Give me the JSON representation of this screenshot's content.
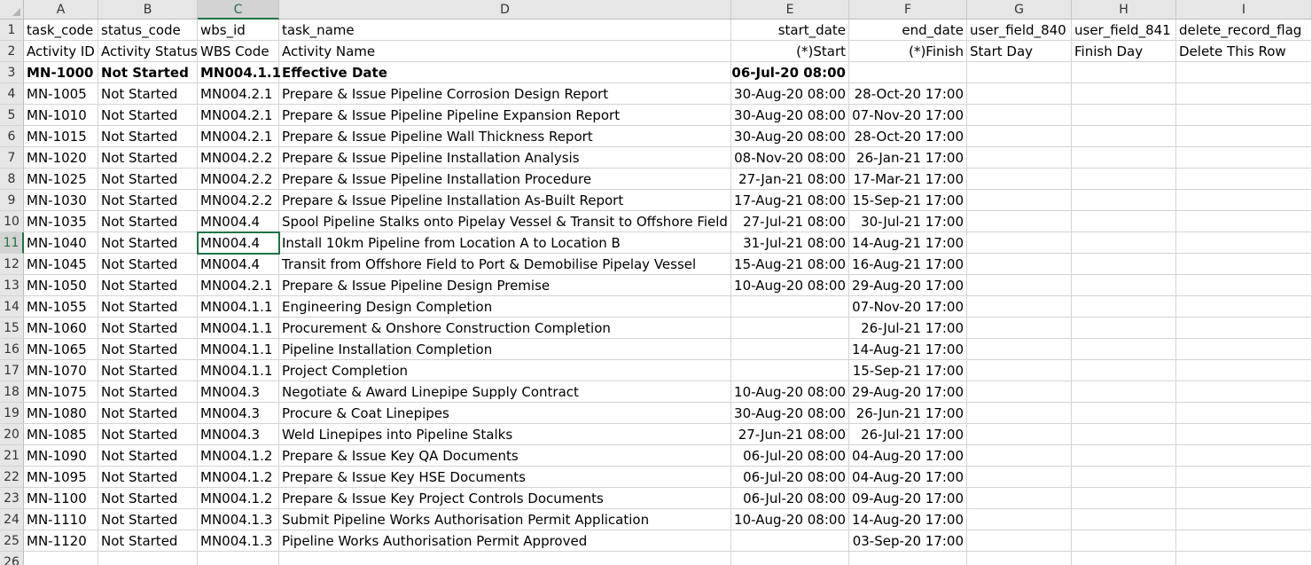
{
  "columns": [
    "A",
    "B",
    "C",
    "D",
    "E",
    "F",
    "G",
    "H",
    "I"
  ],
  "selected_column": "C",
  "selected_row": "11",
  "rows": [
    {
      "num": "1",
      "cells": [
        "task_code",
        "status_code",
        "wbs_id",
        "task_name",
        "start_date",
        "end_date",
        "user_field_840",
        "user_field_841",
        "delete_record_flag"
      ]
    },
    {
      "num": "2",
      "cells": [
        "Activity ID",
        "Activity Status",
        "WBS Code",
        "Activity Name",
        "(*)Start",
        "(*)Finish",
        "Start Day",
        "Finish Day",
        "Delete This Row"
      ]
    },
    {
      "num": "3",
      "bold": true,
      "cells": [
        "MN-1000",
        "Not Started",
        "MN004.1.1",
        "Effective Date",
        "06-Jul-20 08:00",
        "",
        "",
        "",
        ""
      ]
    },
    {
      "num": "4",
      "cells": [
        "MN-1005",
        "Not Started",
        "MN004.2.1",
        "Prepare & Issue Pipeline Corrosion Design Report",
        "30-Aug-20 08:00",
        "28-Oct-20 17:00",
        "",
        "",
        ""
      ]
    },
    {
      "num": "5",
      "cells": [
        "MN-1010",
        "Not Started",
        "MN004.2.1",
        "Prepare & Issue Pipeline Pipeline Expansion Report",
        "30-Aug-20 08:00",
        "07-Nov-20 17:00",
        "",
        "",
        ""
      ]
    },
    {
      "num": "6",
      "cells": [
        "MN-1015",
        "Not Started",
        "MN004.2.1",
        "Prepare & Issue Pipeline Wall Thickness Report",
        "30-Aug-20 08:00",
        "28-Oct-20 17:00",
        "",
        "",
        ""
      ]
    },
    {
      "num": "7",
      "cells": [
        "MN-1020",
        "Not Started",
        "MN004.2.2",
        "Prepare & Issue Pipeline Installation Analysis",
        "08-Nov-20 08:00",
        "26-Jan-21 17:00",
        "",
        "",
        ""
      ]
    },
    {
      "num": "8",
      "cells": [
        "MN-1025",
        "Not Started",
        "MN004.2.2",
        "Prepare & Issue Pipeline Installation Procedure",
        "27-Jan-21 08:00",
        "17-Mar-21 17:00",
        "",
        "",
        ""
      ]
    },
    {
      "num": "9",
      "cells": [
        "MN-1030",
        "Not Started",
        "MN004.2.2",
        "Prepare & Issue Pipeline Installation As-Built Report",
        "17-Aug-21 08:00",
        "15-Sep-21 17:00",
        "",
        "",
        ""
      ]
    },
    {
      "num": "10",
      "cells": [
        "MN-1035",
        "Not Started",
        "MN004.4",
        "Spool Pipeline Stalks onto Pipelay Vessel & Transit to Offshore Field",
        "27-Jul-21 08:00",
        "30-Jul-21 17:00",
        "",
        "",
        ""
      ]
    },
    {
      "num": "11",
      "cells": [
        "MN-1040",
        "Not Started",
        "MN004.4",
        "Install 10km Pipeline from Location A to Location B",
        "31-Jul-21 08:00",
        "14-Aug-21 17:00",
        "",
        "",
        ""
      ]
    },
    {
      "num": "12",
      "cells": [
        "MN-1045",
        "Not Started",
        "MN004.4",
        "Transit from Offshore Field to Port & Demobilise Pipelay Vessel",
        "15-Aug-21 08:00",
        "16-Aug-21 17:00",
        "",
        "",
        ""
      ]
    },
    {
      "num": "13",
      "cells": [
        "MN-1050",
        "Not Started",
        "MN004.2.1",
        "Prepare & Issue Pipeline Design Premise",
        "10-Aug-20 08:00",
        "29-Aug-20 17:00",
        "",
        "",
        ""
      ]
    },
    {
      "num": "14",
      "cells": [
        "MN-1055",
        "Not Started",
        "MN004.1.1",
        "Engineering Design Completion",
        "",
        "07-Nov-20 17:00",
        "",
        "",
        ""
      ]
    },
    {
      "num": "15",
      "cells": [
        "MN-1060",
        "Not Started",
        "MN004.1.1",
        "Procurement & Onshore Construction Completion",
        "",
        "26-Jul-21 17:00",
        "",
        "",
        ""
      ]
    },
    {
      "num": "16",
      "cells": [
        "MN-1065",
        "Not Started",
        "MN004.1.1",
        "Pipeline Installation Completion",
        "",
        "14-Aug-21 17:00",
        "",
        "",
        ""
      ]
    },
    {
      "num": "17",
      "cells": [
        "MN-1070",
        "Not Started",
        "MN004.1.1",
        "Project Completion",
        "",
        "15-Sep-21 17:00",
        "",
        "",
        ""
      ]
    },
    {
      "num": "18",
      "cells": [
        "MN-1075",
        "Not Started",
        "MN004.3",
        "Negotiate & Award Linepipe Supply Contract",
        "10-Aug-20 08:00",
        "29-Aug-20 17:00",
        "",
        "",
        ""
      ]
    },
    {
      "num": "19",
      "cells": [
        "MN-1080",
        "Not Started",
        "MN004.3",
        "Procure & Coat Linepipes",
        "30-Aug-20 08:00",
        "26-Jun-21 17:00",
        "",
        "",
        ""
      ]
    },
    {
      "num": "20",
      "cells": [
        "MN-1085",
        "Not Started",
        "MN004.3",
        "Weld Linepipes into Pipeline Stalks",
        "27-Jun-21 08:00",
        "26-Jul-21 17:00",
        "",
        "",
        ""
      ]
    },
    {
      "num": "21",
      "cells": [
        "MN-1090",
        "Not Started",
        "MN004.1.2",
        "Prepare & Issue Key QA Documents",
        "06-Jul-20 08:00",
        "04-Aug-20 17:00",
        "",
        "",
        ""
      ]
    },
    {
      "num": "22",
      "cells": [
        "MN-1095",
        "Not Started",
        "MN004.1.2",
        "Prepare & Issue Key HSE Documents",
        "06-Jul-20 08:00",
        "04-Aug-20 17:00",
        "",
        "",
        ""
      ]
    },
    {
      "num": "23",
      "cells": [
        "MN-1100",
        "Not Started",
        "MN004.1.2",
        "Prepare & Issue Key Project Controls Documents",
        "06-Jul-20 08:00",
        "09-Aug-20 17:00",
        "",
        "",
        ""
      ]
    },
    {
      "num": "24",
      "cells": [
        "MN-1110",
        "Not Started",
        "MN004.1.3",
        "Submit Pipeline Works Authorisation Permit Application",
        "10-Aug-20 08:00",
        "14-Aug-20 17:00",
        "",
        "",
        ""
      ]
    },
    {
      "num": "25",
      "cells": [
        "MN-1120",
        "Not Started",
        "MN004.1.3",
        "Pipeline Works Authorisation Permit Approved",
        "",
        "03-Sep-20 17:00",
        "",
        "",
        ""
      ]
    },
    {
      "num": "26",
      "cells": [
        "",
        "",
        "",
        "",
        "",
        "",
        "",
        "",
        ""
      ]
    }
  ]
}
